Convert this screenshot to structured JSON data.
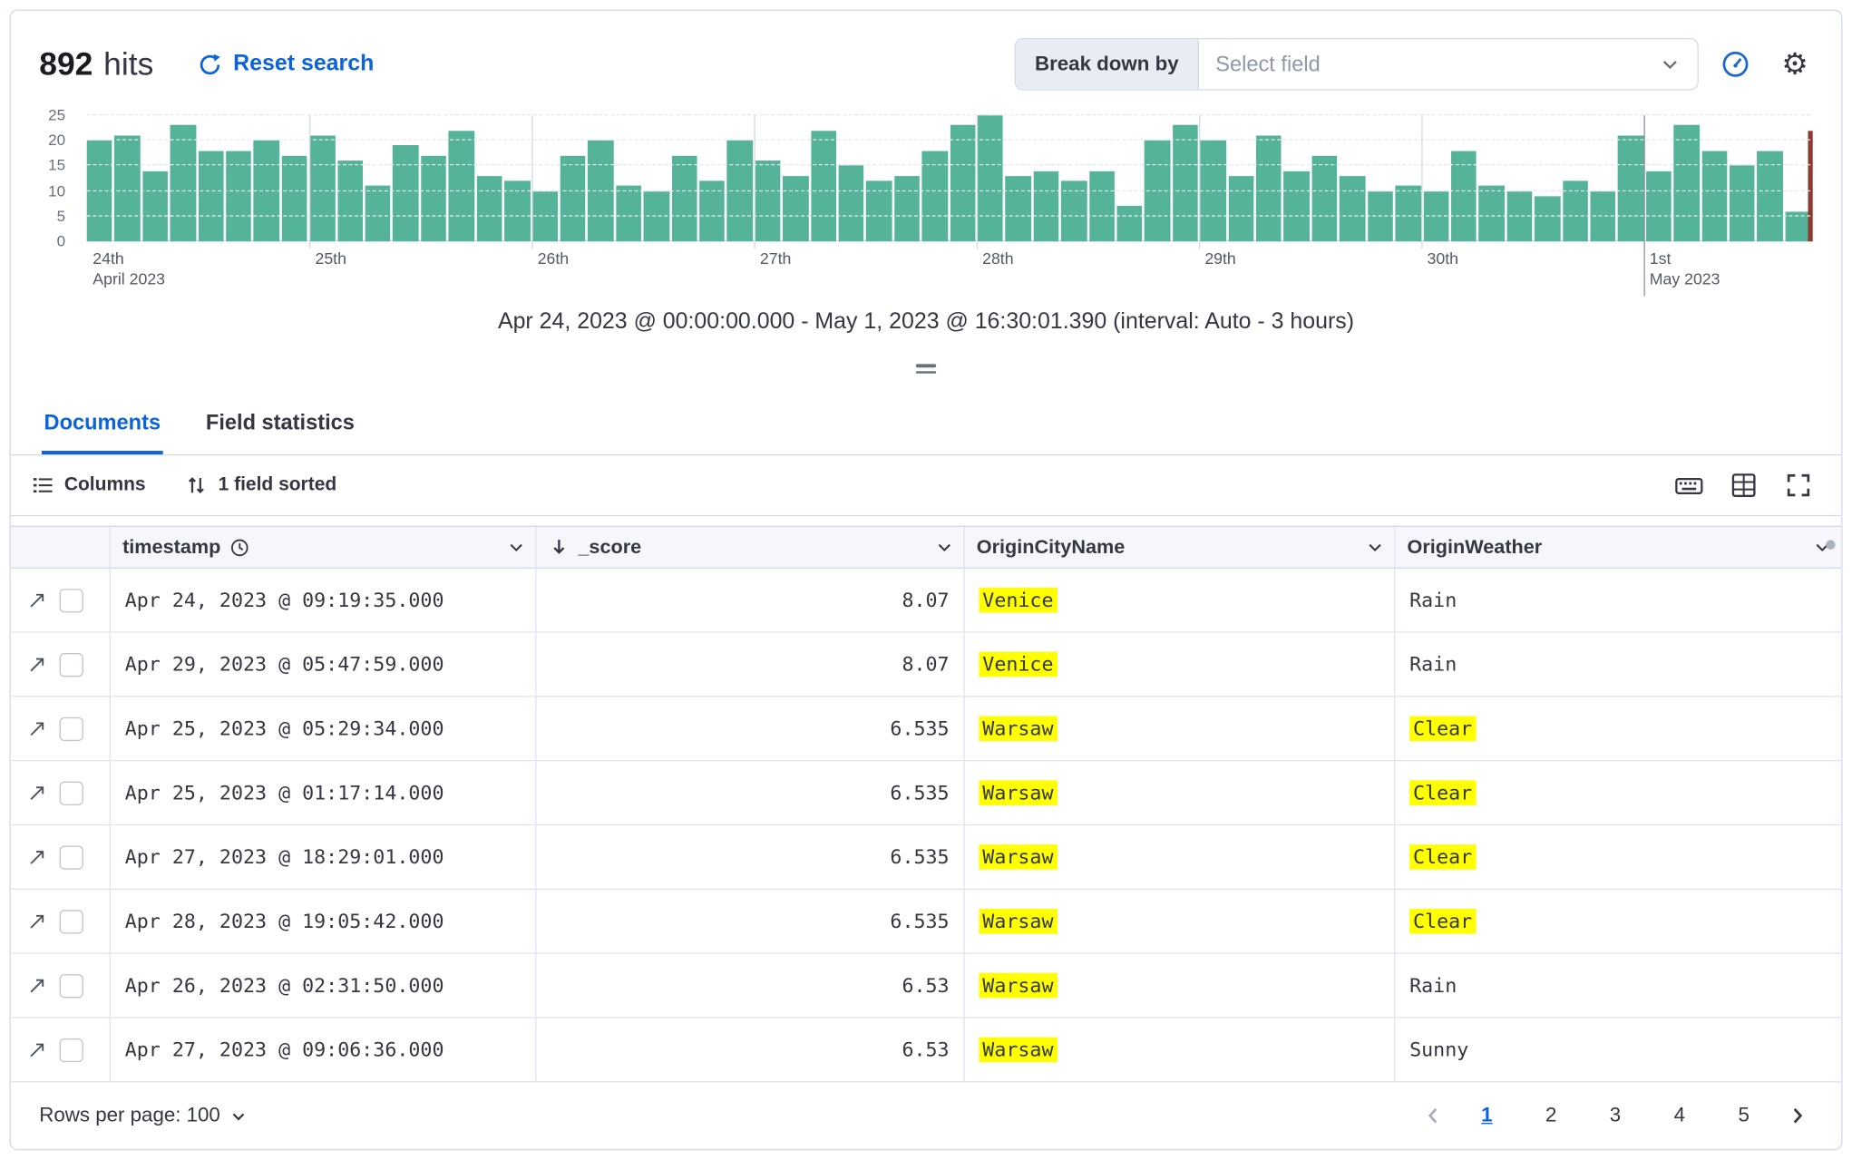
{
  "header": {
    "hits_count": "892",
    "hits_label": "hits",
    "reset_search_label": "Reset search",
    "break_down_label": "Break down by",
    "select_field_placeholder": "Select field"
  },
  "chart_data": {
    "type": "bar",
    "title": "Apr 24, 2023 @ 00:00:00.000 - May 1, 2023 @ 16:30:01.390 (interval: Auto - 3 hours)",
    "xlabel": "",
    "ylabel": "",
    "ylim": [
      0,
      25
    ],
    "y_ticks": [
      0,
      5,
      10,
      15,
      20,
      25
    ],
    "grid": true,
    "legend": "none",
    "interval": "3 hours",
    "bar_color": "#54b399",
    "current_time_marker_color": "#8e3a31",
    "x_day_ticks": [
      {
        "index": 0,
        "line1": "24th",
        "line2": "April 2023"
      },
      {
        "index": 8,
        "line1": "25th",
        "line2": ""
      },
      {
        "index": 16,
        "line1": "26th",
        "line2": ""
      },
      {
        "index": 24,
        "line1": "27th",
        "line2": ""
      },
      {
        "index": 32,
        "line1": "28th",
        "line2": ""
      },
      {
        "index": 40,
        "line1": "29th",
        "line2": ""
      },
      {
        "index": 48,
        "line1": "30th",
        "line2": ""
      },
      {
        "index": 56,
        "line1": "1st",
        "line2": "May 2023"
      }
    ],
    "values": [
      20,
      21,
      14,
      23,
      18,
      18,
      20,
      17,
      21,
      16,
      11,
      19,
      17,
      22,
      13,
      12,
      10,
      17,
      20,
      11,
      10,
      17,
      12,
      20,
      16,
      13,
      22,
      15,
      12,
      13,
      18,
      23,
      25,
      13,
      14,
      12,
      14,
      7,
      20,
      23,
      20,
      13,
      21,
      14,
      17,
      13,
      10,
      11,
      10,
      18,
      11,
      10,
      9,
      12,
      10,
      21,
      14,
      23,
      18,
      15,
      18,
      6
    ]
  },
  "tabs": [
    {
      "label": "Documents",
      "active": true
    },
    {
      "label": "Field statistics",
      "active": false
    }
  ],
  "grid_toolbar": {
    "columns_label": "Columns",
    "sort_label": "1 field sorted"
  },
  "table": {
    "columns": [
      {
        "label": "timestamp"
      },
      {
        "label": "_score"
      },
      {
        "label": "OriginCityName"
      },
      {
        "label": "OriginWeather"
      }
    ],
    "rows": [
      {
        "timestamp": "Apr 24, 2023 @ 09:19:35.000",
        "score": "8.07",
        "city": "Venice",
        "city_hl": true,
        "weather": "Rain",
        "weather_hl": false
      },
      {
        "timestamp": "Apr 29, 2023 @ 05:47:59.000",
        "score": "8.07",
        "city": "Venice",
        "city_hl": true,
        "weather": "Rain",
        "weather_hl": false
      },
      {
        "timestamp": "Apr 25, 2023 @ 05:29:34.000",
        "score": "6.535",
        "city": "Warsaw",
        "city_hl": true,
        "weather": "Clear",
        "weather_hl": true
      },
      {
        "timestamp": "Apr 25, 2023 @ 01:17:14.000",
        "score": "6.535",
        "city": "Warsaw",
        "city_hl": true,
        "weather": "Clear",
        "weather_hl": true
      },
      {
        "timestamp": "Apr 27, 2023 @ 18:29:01.000",
        "score": "6.535",
        "city": "Warsaw",
        "city_hl": true,
        "weather": "Clear",
        "weather_hl": true
      },
      {
        "timestamp": "Apr 28, 2023 @ 19:05:42.000",
        "score": "6.535",
        "city": "Warsaw",
        "city_hl": true,
        "weather": "Clear",
        "weather_hl": true
      },
      {
        "timestamp": "Apr 26, 2023 @ 02:31:50.000",
        "score": "6.53",
        "city": "Warsaw",
        "city_hl": true,
        "weather": "Rain",
        "weather_hl": false
      },
      {
        "timestamp": "Apr 27, 2023 @ 09:06:36.000",
        "score": "6.53",
        "city": "Warsaw",
        "city_hl": true,
        "weather": "Sunny",
        "weather_hl": false
      }
    ]
  },
  "footer": {
    "rows_per_page_label": "Rows per page: 100",
    "pages": [
      "1",
      "2",
      "3",
      "4",
      "5"
    ],
    "active_page": "1"
  },
  "colors": {
    "primary_blue": "#0b64dd",
    "bar_green": "#54b399",
    "highlight_yellow": "#ffff00",
    "text": "#343741",
    "border": "#d3dae6"
  }
}
